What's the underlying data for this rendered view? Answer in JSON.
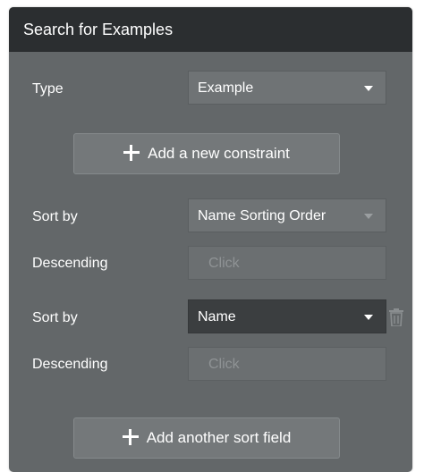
{
  "panel": {
    "title": "Search for Examples"
  },
  "type_row": {
    "label": "Type",
    "value": "Example"
  },
  "add_constraint_button": {
    "label": "Add a new constraint"
  },
  "sort1": {
    "label": "Sort by",
    "value": "Name Sorting Order",
    "descending_label": "Descending",
    "descending_value": "Click"
  },
  "sort2": {
    "label": "Sort by",
    "value": "Name",
    "descending_label": "Descending",
    "descending_value": "Click"
  },
  "add_sort_button": {
    "label": "Add another sort field"
  },
  "colors": {
    "panel_bg": "#636769",
    "header_bg": "#2b2e30",
    "active_dropdown_bg": "#3b3e40"
  }
}
